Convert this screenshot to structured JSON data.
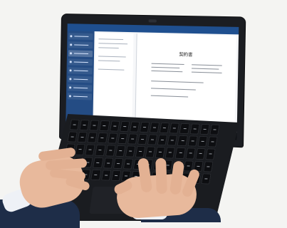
{
  "screen": {
    "brand": "",
    "document_title": "契約書"
  },
  "colors": {
    "background": "#f4f4f2",
    "laptop": "#1b1d22",
    "app_header": "#1f4f8f",
    "sidebar": "#244c84",
    "skin": "#e8b99c",
    "suit": "#1e2d48"
  }
}
